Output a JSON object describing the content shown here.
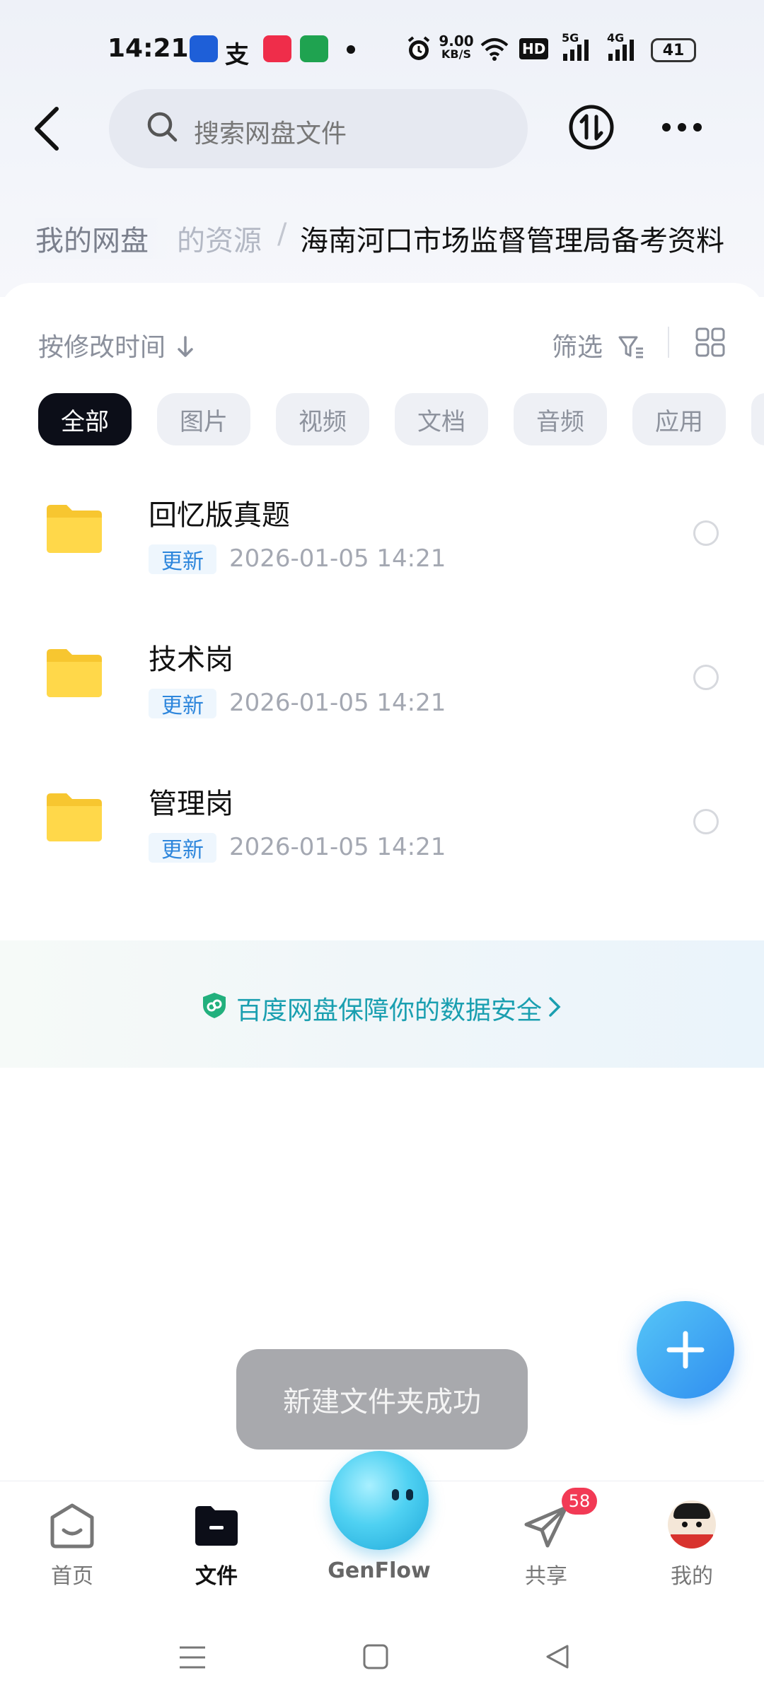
{
  "status_bar": {
    "time": "14:21",
    "net_speed_top": "9.00",
    "net_speed_bottom": "KB/S",
    "hd_label": "HD",
    "signal1_label": "5G",
    "signal2_label": "4G",
    "battery": "41"
  },
  "header": {
    "search_placeholder": "搜索网盘文件"
  },
  "breadcrumb": {
    "home": "我的网盘",
    "middle": "的资源",
    "separator": "/",
    "current": "海南河口市场监督管理局备考资料"
  },
  "toolbar": {
    "sort_label": "按修改时间",
    "filter_label": "筛选"
  },
  "chips": [
    {
      "label": "全部",
      "active": true
    },
    {
      "label": "图片",
      "active": false
    },
    {
      "label": "视频",
      "active": false
    },
    {
      "label": "文档",
      "active": false
    },
    {
      "label": "音频",
      "active": false
    },
    {
      "label": "应用",
      "active": false
    }
  ],
  "files": [
    {
      "name": "回忆版真题",
      "badge": "更新",
      "date": "2026-01-05  14:21"
    },
    {
      "name": "技术岗",
      "badge": "更新",
      "date": "2026-01-05  14:21"
    },
    {
      "name": "管理岗",
      "badge": "更新",
      "date": "2026-01-05  14:21"
    }
  ],
  "security": {
    "text": "百度网盘保障你的数据安全"
  },
  "toast": {
    "text": "新建文件夹成功"
  },
  "bottom_nav": {
    "home": "首页",
    "files": "文件",
    "genflow": "GenFlow",
    "share": "共享",
    "share_badge": "58",
    "mine": "我的"
  },
  "colors": {
    "accent_blue": "#2f8df0",
    "badge_blue": "#2d86dc",
    "security_teal": "#1a9fb0",
    "folder_yellow": "#ffd23f"
  }
}
